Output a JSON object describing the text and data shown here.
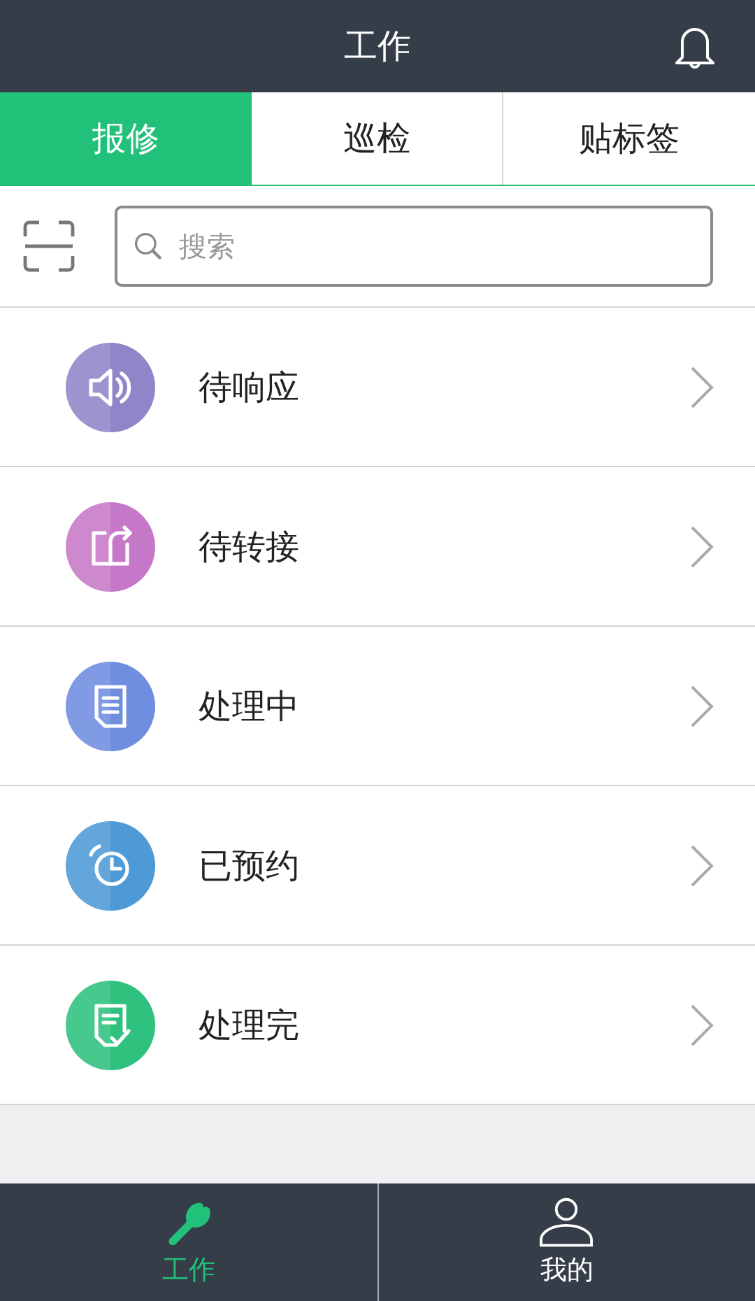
{
  "header": {
    "title": "工作"
  },
  "tabs": [
    {
      "label": "报修",
      "selected": true
    },
    {
      "label": "巡检",
      "selected": false
    },
    {
      "label": "贴标签",
      "selected": false
    }
  ],
  "search": {
    "placeholder": "搜索"
  },
  "items": [
    {
      "label": "待响应",
      "kind": "speaker",
      "color": "#8f86c9"
    },
    {
      "label": "待转接",
      "kind": "transfer",
      "color": "#c678c8"
    },
    {
      "label": "处理中",
      "kind": "document",
      "color": "#6f8ee0"
    },
    {
      "label": "已预约",
      "kind": "alarm",
      "color": "#4d9ad6"
    },
    {
      "label": "处理完",
      "kind": "done",
      "color": "#2ec27e"
    }
  ],
  "nav": [
    {
      "label": "工作",
      "kind": "wrench",
      "selected": true
    },
    {
      "label": "我的",
      "kind": "person",
      "selected": false
    }
  ]
}
